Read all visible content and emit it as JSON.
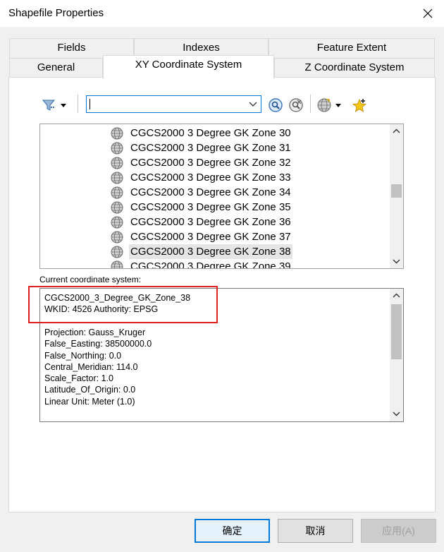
{
  "window": {
    "title": "Shapefile Properties"
  },
  "tabs": {
    "row1": [
      "Fields",
      "Indexes",
      "Feature Extent"
    ],
    "row2": [
      "General",
      "XY Coordinate System",
      "Z Coordinate System"
    ]
  },
  "toolbar": {
    "search_value": ""
  },
  "coordinate_list": {
    "items": [
      "CGCS2000 3 Degree GK Zone 30",
      "CGCS2000 3 Degree GK Zone 31",
      "CGCS2000 3 Degree GK Zone 32",
      "CGCS2000 3 Degree GK Zone 33",
      "CGCS2000 3 Degree GK Zone 34",
      "CGCS2000 3 Degree GK Zone 35",
      "CGCS2000 3 Degree GK Zone 36",
      "CGCS2000 3 Degree GK Zone 37",
      "CGCS2000 3 Degree GK Zone 38",
      "CGCS2000 3 Degree GK Zone 39"
    ],
    "selected": "CGCS2000 3 Degree GK Zone 38"
  },
  "current": {
    "label": "Current coordinate system:",
    "lines": [
      "CGCS2000_3_Degree_GK_Zone_38",
      "WKID: 4526 Authority: EPSG",
      "",
      "Projection: Gauss_Kruger",
      "False_Easting: 38500000.0",
      "False_Northing: 0.0",
      "Central_Meridian: 114.0",
      "Scale_Factor: 1.0",
      "Latitude_Of_Origin: 0.0",
      "Linear Unit: Meter (1.0)"
    ]
  },
  "buttons": {
    "ok": "确定",
    "cancel": "取消",
    "apply": "应用(A)"
  }
}
